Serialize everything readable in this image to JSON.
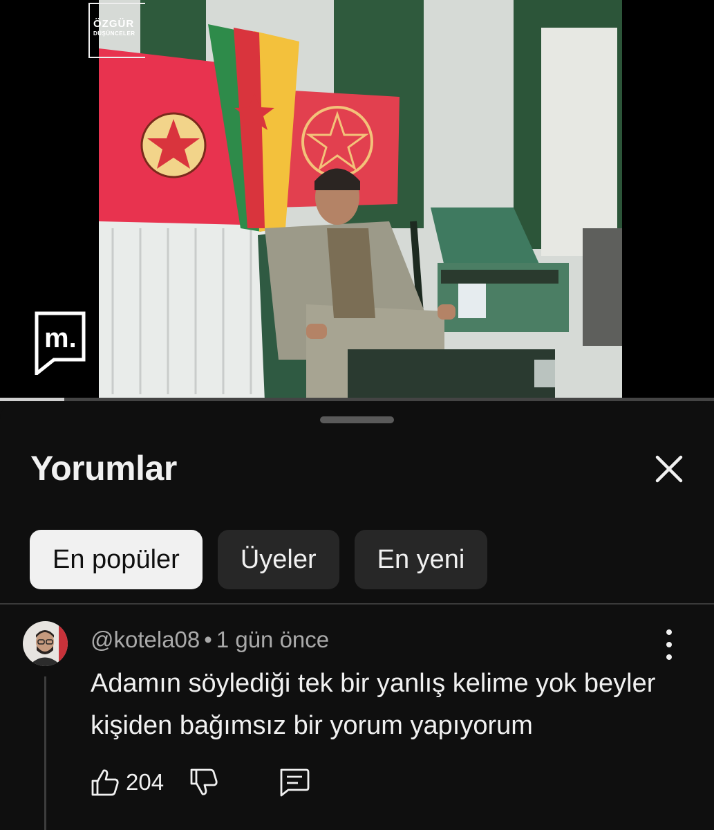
{
  "video": {
    "watermark_top": "ÖZGÜR",
    "watermark_sub": "DÜŞÜNCELER",
    "watermark_logo": "m.",
    "progress_fraction": 0.09
  },
  "comments_panel": {
    "title": "Yorumlar",
    "close_icon": "close-icon",
    "filters": [
      {
        "label": "En popüler",
        "active": true
      },
      {
        "label": "Üyeler",
        "active": false
      },
      {
        "label": "En yeni",
        "active": false
      }
    ]
  },
  "comment": {
    "author": "@kotela08",
    "separator": "•",
    "time": "1 gün önce",
    "text": "Adamın söylediği tek bir yanlış kelime yok beyler kişiden bağımsız bir yorum yapıyorum",
    "like_count": "204",
    "icons": [
      "like-icon",
      "dislike-icon",
      "reply-icon",
      "more-vert-icon"
    ]
  }
}
